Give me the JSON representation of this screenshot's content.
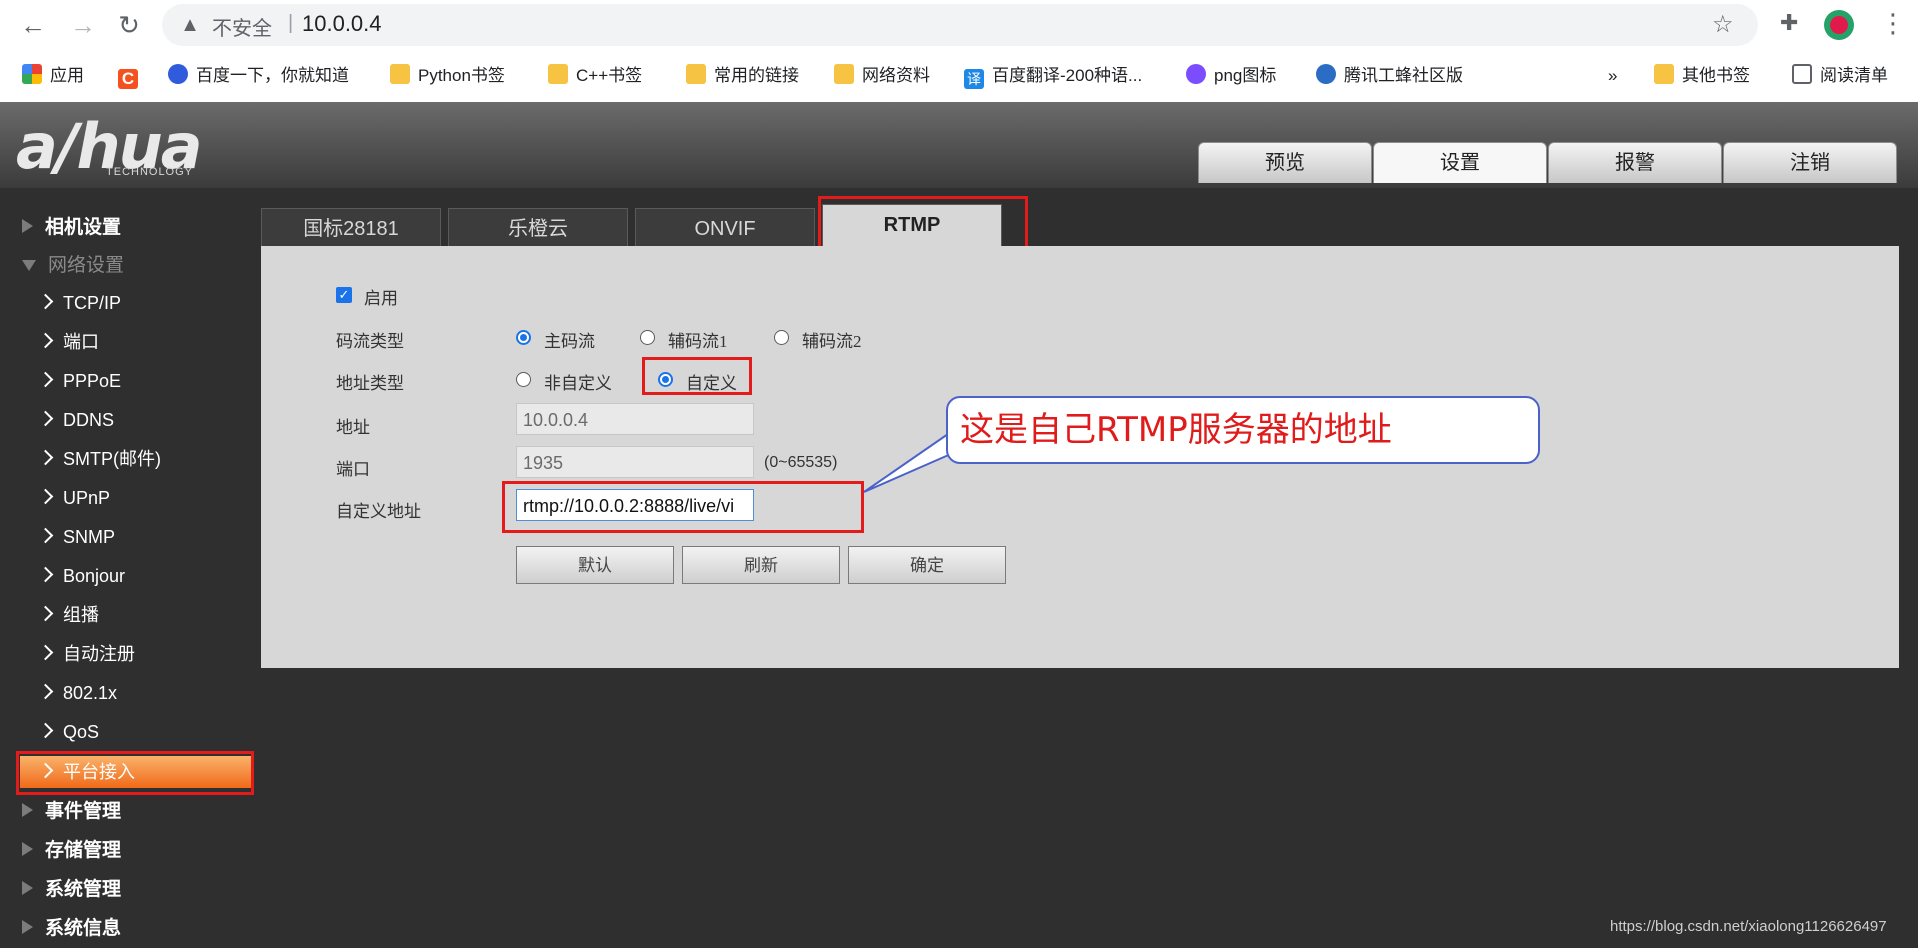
{
  "browser": {
    "insecure_label": "不安全",
    "separator": "|",
    "url": "10.0.0.4",
    "bookmarks": [
      {
        "label": "应用"
      },
      {
        "label": ""
      },
      {
        "label": "百度一下，你就知道"
      },
      {
        "label": "Python书签"
      },
      {
        "label": "C++书签"
      },
      {
        "label": "常用的链接"
      },
      {
        "label": "网络资料"
      },
      {
        "label": "百度翻译-200种语..."
      },
      {
        "label": "png图标"
      },
      {
        "label": "腾讯工蜂社区版"
      }
    ],
    "overflow": "»",
    "other_bookmarks": "其他书签",
    "reading_list": "阅读清单"
  },
  "app": {
    "logo_text": "a/hua",
    "logo_sub": "TECHNOLOGY",
    "top_tabs": [
      "预览",
      "设置",
      "报警",
      "注销"
    ],
    "sidebar": {
      "groups": [
        "相机设置",
        "网络设置",
        "事件管理",
        "存储管理",
        "系统管理",
        "系统信息"
      ],
      "network_items": [
        "TCP/IP",
        "端口",
        "PPPoE",
        "DDNS",
        "SMTP(邮件)",
        "UPnP",
        "SNMP",
        "Bonjour",
        "组播",
        "自动注册",
        "802.1x",
        "QoS",
        "平台接入"
      ]
    },
    "sub_tabs": [
      "国标28181",
      "乐橙云",
      "ONVIF",
      "RTMP"
    ],
    "form": {
      "enable_label": "启用",
      "stream_type_label": "码流类型",
      "stream_options": [
        "主码流",
        "辅码流1",
        "辅码流2"
      ],
      "address_type_label": "地址类型",
      "address_options": [
        "非自定义",
        "自定义"
      ],
      "address_label": "地址",
      "address_value": "10.0.0.4",
      "port_label": "端口",
      "port_value": "1935",
      "port_range": "(0~65535)",
      "custom_address_label": "自定义地址",
      "custom_address_value": "rtmp://10.0.0.2:8888/live/vi",
      "buttons": [
        "默认",
        "刷新",
        "确定"
      ]
    },
    "callout": "这是自己RTMP服务器的地址",
    "watermark": "https://blog.csdn.net/xiaolong1126626497"
  }
}
